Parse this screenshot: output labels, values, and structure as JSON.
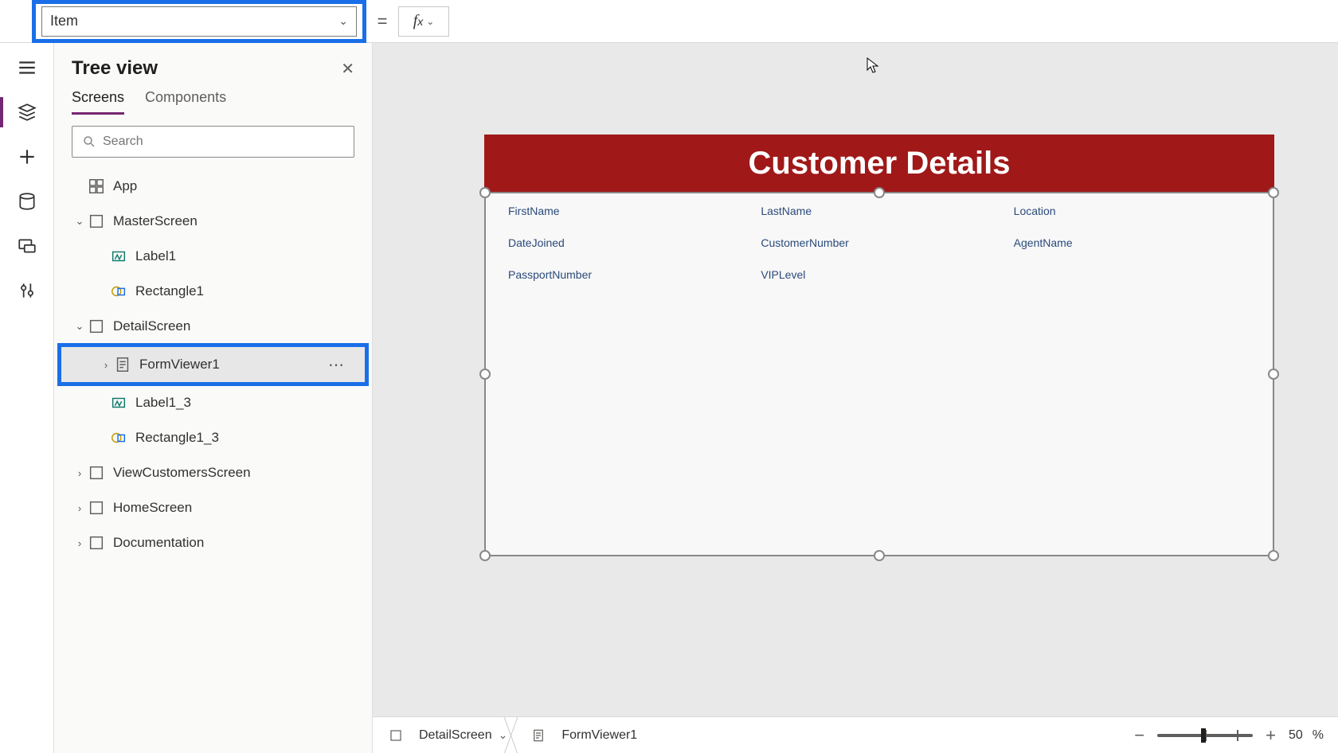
{
  "property_dropdown": {
    "value": "Item"
  },
  "formula_bar": {
    "value": ""
  },
  "panel": {
    "title": "Tree view",
    "tabs": {
      "screens": "Screens",
      "components": "Components"
    },
    "search_placeholder": "Search"
  },
  "tree": {
    "app": "App",
    "master": "MasterScreen",
    "label1": "Label1",
    "rect1": "Rectangle1",
    "detail": "DetailScreen",
    "formviewer": "FormViewer1",
    "label1_3": "Label1_3",
    "rect1_3": "Rectangle1_3",
    "viewcust": "ViewCustomersScreen",
    "home": "HomeScreen",
    "doc": "Documentation"
  },
  "canvas": {
    "title": "Customer Details",
    "fields": {
      "f1": "FirstName",
      "f2": "LastName",
      "f3": "Location",
      "f4": "DateJoined",
      "f5": "CustomerNumber",
      "f6": "AgentName",
      "f7": "PassportNumber",
      "f8": "VIPLevel"
    }
  },
  "breadcrumb": {
    "screen": "DetailScreen",
    "control": "FormViewer1"
  },
  "zoom": {
    "value": "50",
    "suffix": "%"
  }
}
